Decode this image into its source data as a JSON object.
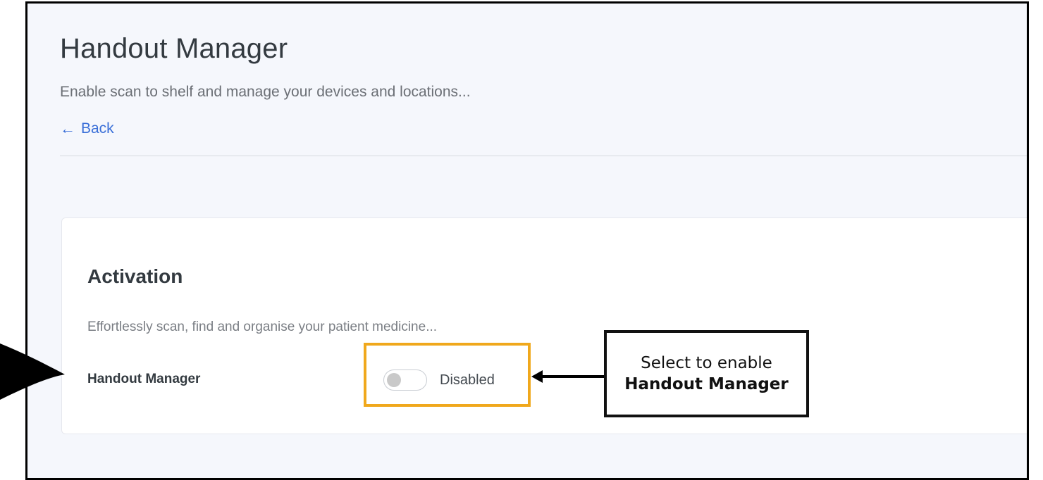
{
  "page": {
    "title": "Handout Manager",
    "subtitle": "Enable scan to shelf and manage your devices and locations...",
    "back_label": "Back",
    "back_icon": "arrow-left-icon"
  },
  "card": {
    "title": "Activation",
    "description": "Effortlessly scan, find and organise your patient medicine...",
    "setting_label": "Handout Manager",
    "toggle_state": "Disabled",
    "toggle_on": false
  },
  "annotation": {
    "callout_line1": "Select to enable",
    "callout_line2": "Handout Manager",
    "highlight_color": "#f0a81c"
  },
  "colors": {
    "link": "#3a6fd8",
    "background": "#f5f7fc",
    "card": "#ffffff"
  }
}
